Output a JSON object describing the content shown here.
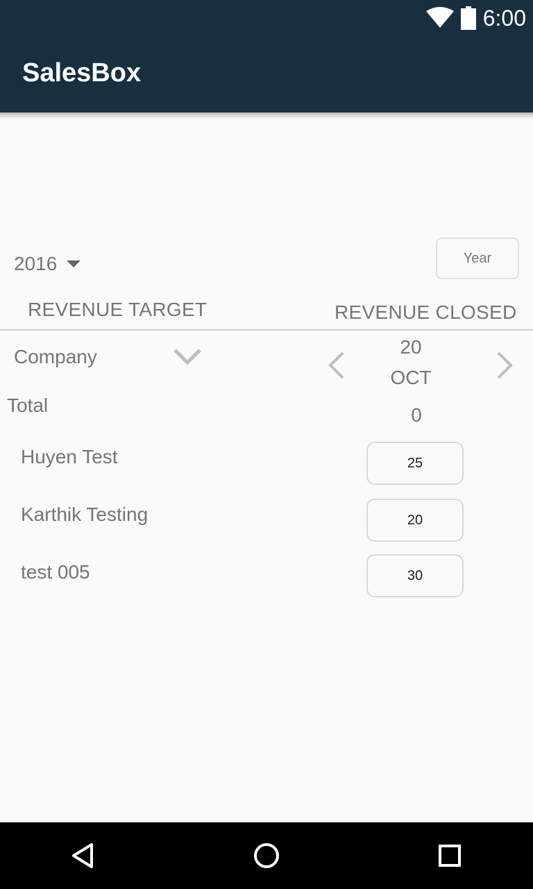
{
  "status_bar": {
    "time": "6:00",
    "wifi_icon": "wifi-icon",
    "battery_icon": "battery-icon"
  },
  "app_bar": {
    "title": "SalesBox"
  },
  "filters": {
    "year": "2016",
    "period_button": "Year"
  },
  "columns": {
    "target_header": "REVENUE TARGET",
    "closed_header": "REVENUE CLOSED"
  },
  "company_select": {
    "label": "Company"
  },
  "period": {
    "day": "20",
    "month": "OCT"
  },
  "total": {
    "label": "Total",
    "value": "0"
  },
  "rows": [
    {
      "name": "Huyen Test",
      "value": "25"
    },
    {
      "name": "Karthik Testing",
      "value": "20"
    },
    {
      "name": "test 005",
      "value": "30"
    }
  ],
  "colors": {
    "app_bar": "#172f3f",
    "background": "#fafafa",
    "text": "#757575"
  },
  "icons": {
    "previous": "chevron-left-icon",
    "next": "chevron-right-icon",
    "back": "back-triangle-icon",
    "home": "home-circle-icon",
    "recents": "recents-square-icon"
  }
}
